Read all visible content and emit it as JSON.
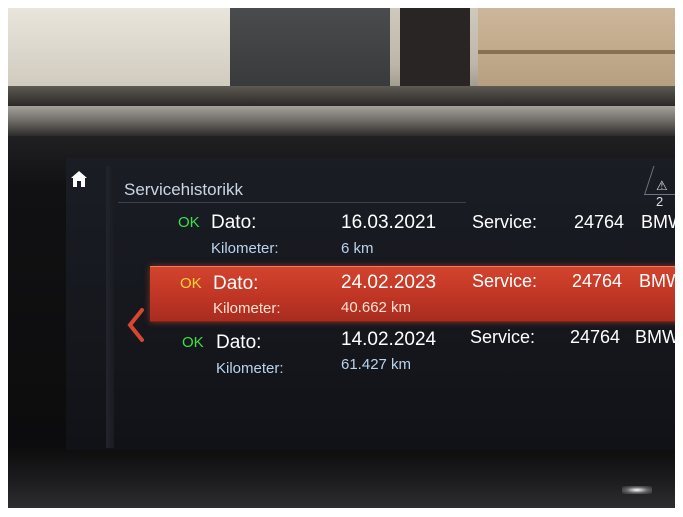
{
  "header": {
    "title": "Servicehistorikk",
    "warning_count": "⚠ 2"
  },
  "rows": [
    {
      "status": "OK",
      "date_label": "Dato:",
      "date": "16.03.2021",
      "km_label": "Kilometer:",
      "km": "6 km",
      "service_label": "Service:",
      "service_code": "24764",
      "brand": "BMW",
      "selected": false
    },
    {
      "status": "OK",
      "date_label": "Dato:",
      "date": "24.02.2023",
      "km_label": "Kilometer:",
      "km": "40.662 km",
      "service_label": "Service:",
      "service_code": "24764",
      "brand": "BMW",
      "selected": true
    },
    {
      "status": "OK",
      "date_label": "Dato:",
      "date": "14.02.2024",
      "km_label": "Kilometer:",
      "km": "61.427 km",
      "service_label": "Service:",
      "service_code": "24764",
      "brand": "BMW",
      "selected": false
    }
  ],
  "colors": {
    "ok_normal": "#3ee04a",
    "ok_selected": "#ffd23a",
    "km_text": "#b9d4ee",
    "highlight": "#c8392a",
    "back_arrow": "#d9462e"
  },
  "icons": {
    "home": "home-icon",
    "back": "chevron-left-icon",
    "warning": "warning-icon"
  }
}
